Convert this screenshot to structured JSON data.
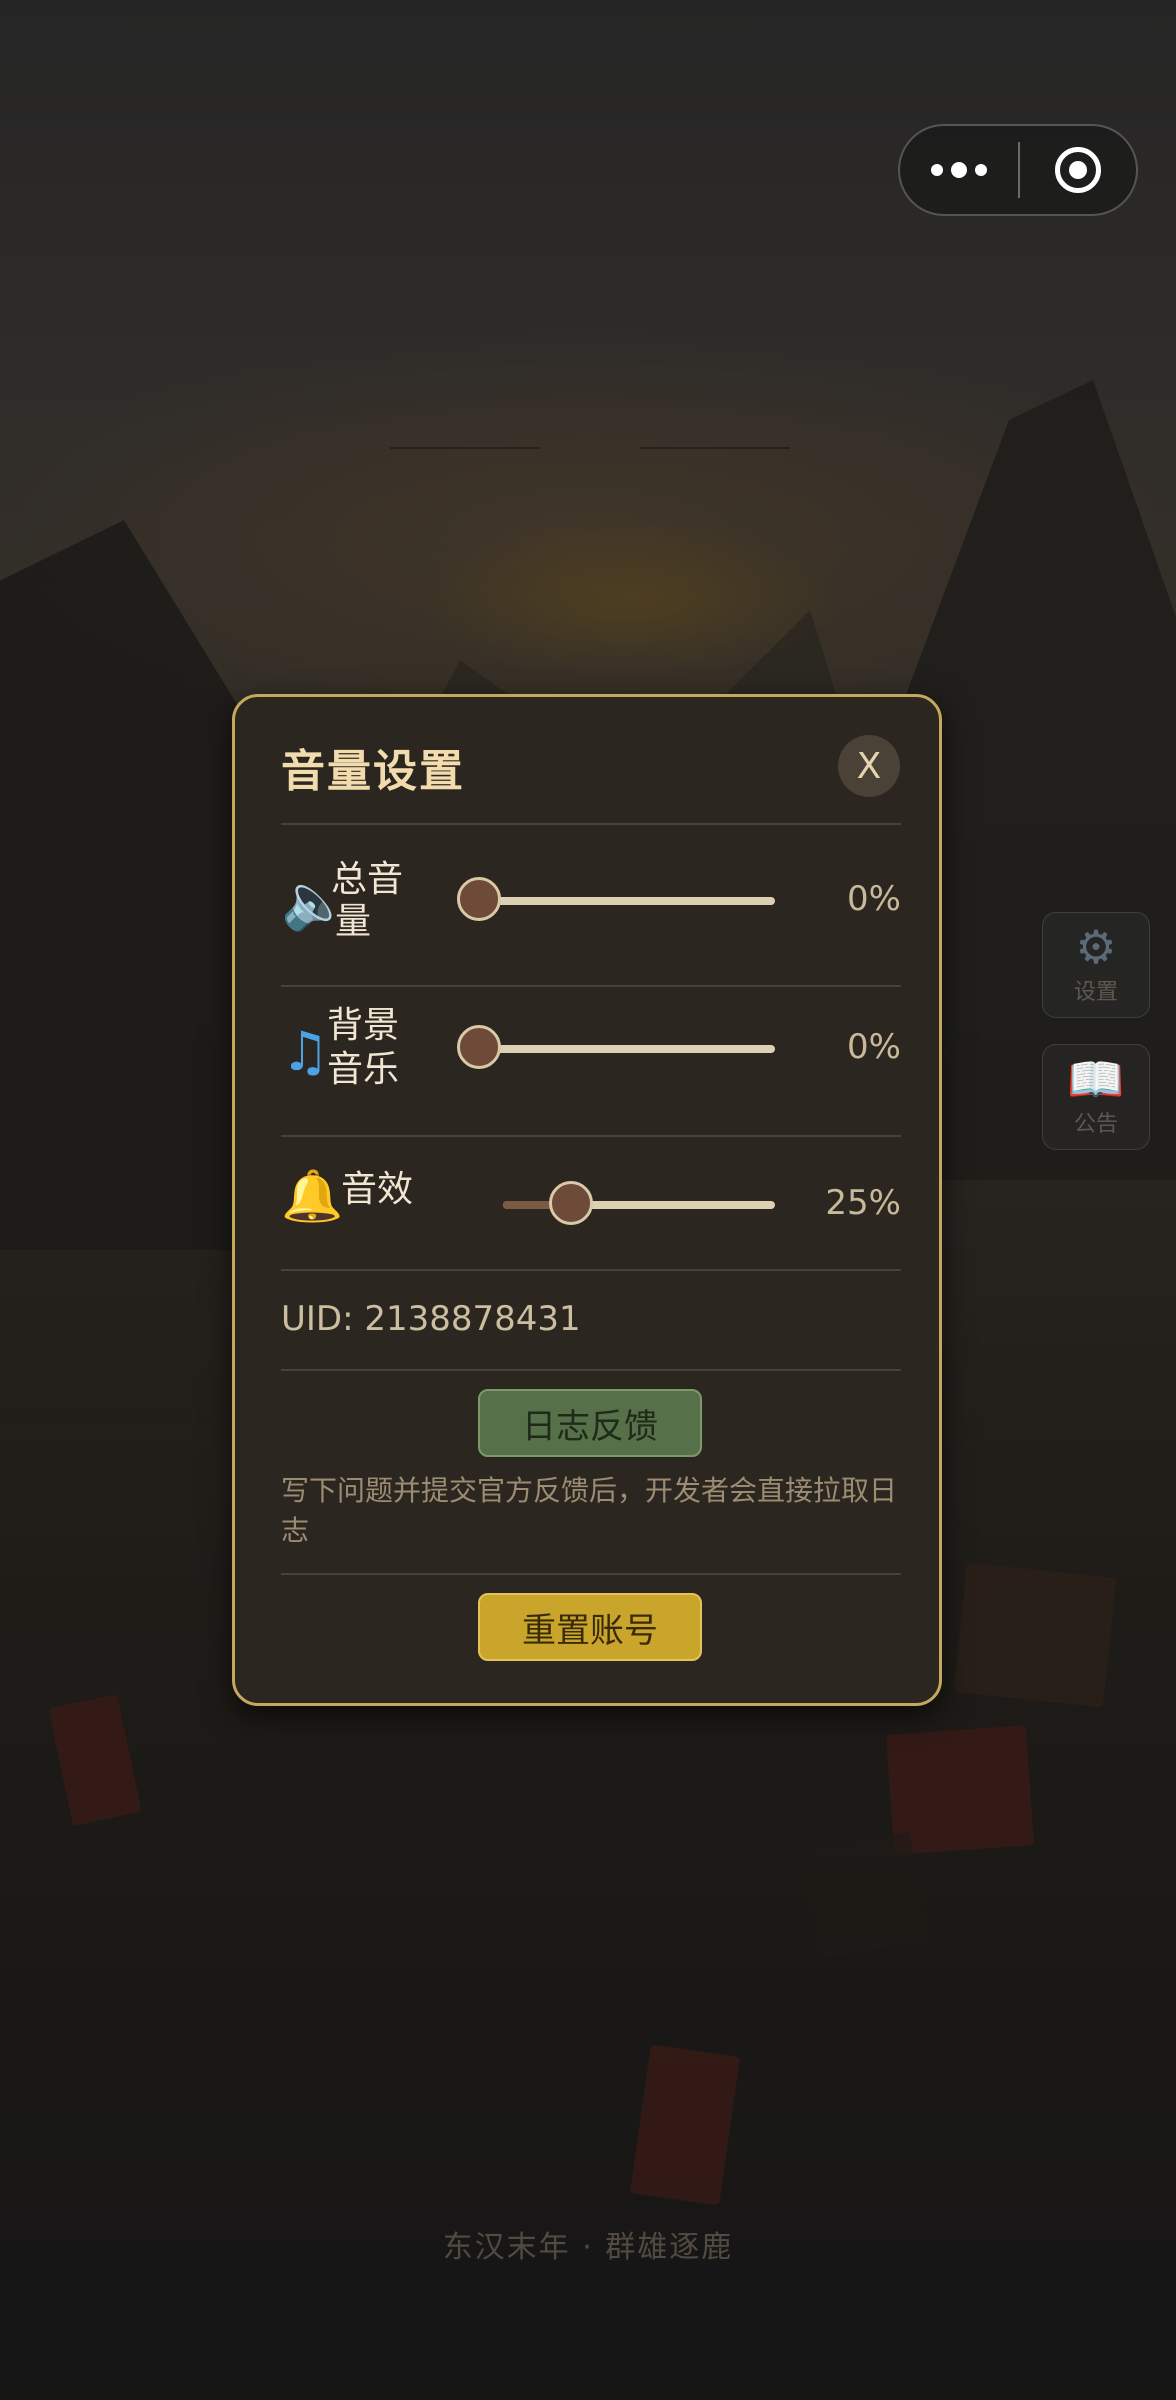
{
  "capsule": {
    "more_icon": "more-dots-icon",
    "close_icon": "target-circle-icon"
  },
  "background": {
    "footer_text": "东汉末年 · 群雄逐鹿"
  },
  "side_buttons": [
    {
      "icon": "gear-icon",
      "glyph": "⚙",
      "label": "设置"
    },
    {
      "icon": "book-icon",
      "glyph": "📖",
      "label": "公告"
    }
  ],
  "dialog": {
    "title": "音量设置",
    "close_label": "X",
    "rows": [
      {
        "icon": "speaker-icon",
        "glyph": "🔈",
        "label_line1": "总音",
        "label_line2": "量",
        "value_percent": 0,
        "display": "0%"
      },
      {
        "icon": "music-note-icon",
        "glyph": "♫",
        "label_line1": "背景",
        "label_line2": "音乐",
        "value_percent": 0,
        "display": "0%"
      },
      {
        "icon": "bell-icon",
        "glyph": "🔔",
        "label_line1": "音效",
        "label_line2": "",
        "value_percent": 25,
        "display": "25%"
      }
    ],
    "uid_text": "UID: 2138878431",
    "feedback_button": "日志反馈",
    "hint_text": "写下问题并提交官方反馈后，开发者会直接拉取日志",
    "reset_button": "重置账号"
  },
  "colors": {
    "dialog_border": "#c4a85c",
    "dialog_bg": "#2c2620",
    "title_color": "#f2dcae",
    "feedback_btn": "#56704a",
    "reset_btn": "#c9a52c"
  }
}
